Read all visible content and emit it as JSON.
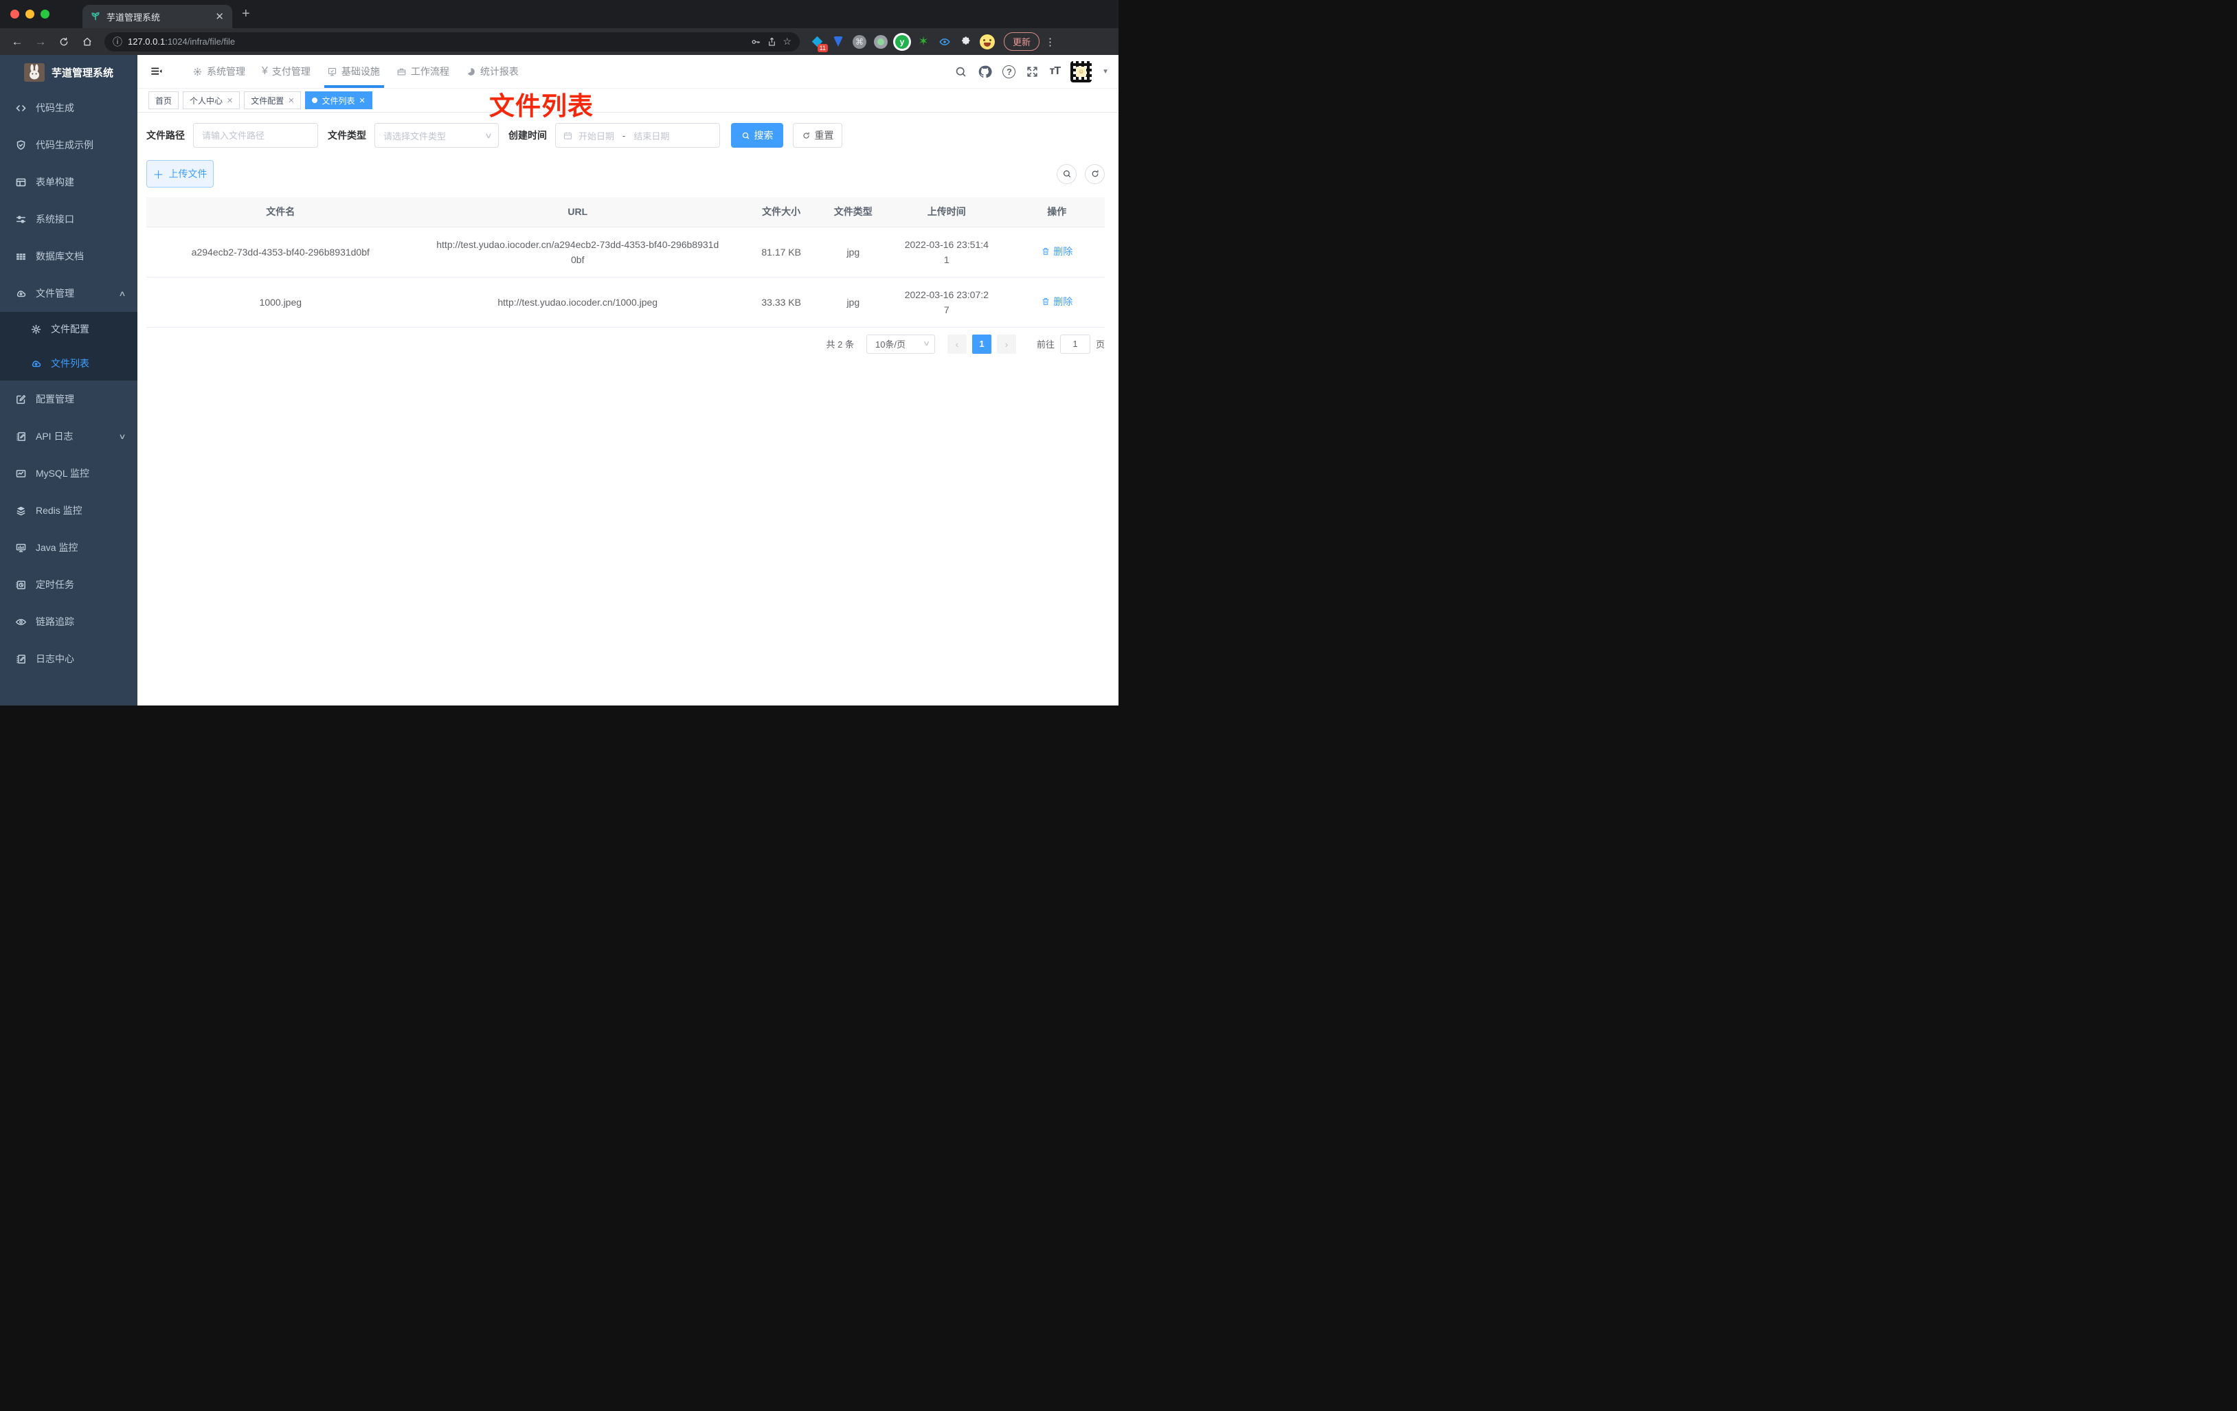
{
  "browser": {
    "tab_title": "芋道管理系统",
    "url_host": "127.0.0.1",
    "url_rest": ":1024/infra/file/file",
    "ext_badge": "11",
    "update_label": "更新"
  },
  "sidebar": {
    "title": "芋道管理系统",
    "items": [
      {
        "label": "代码生成",
        "icon": "code-icon"
      },
      {
        "label": "代码生成示例",
        "icon": "shield-check-icon"
      },
      {
        "label": "表单构建",
        "icon": "form-icon"
      },
      {
        "label": "系统接口",
        "icon": "sliders-icon"
      },
      {
        "label": "数据库文档",
        "icon": "table-icon"
      },
      {
        "label": "文件管理",
        "icon": "cloud-download-icon",
        "expanded": true
      },
      {
        "label": "文件配置",
        "icon": "gear-icon",
        "sub": true
      },
      {
        "label": "文件列表",
        "icon": "cloud-upload-icon",
        "sub": true,
        "active": true
      },
      {
        "label": "配置管理",
        "icon": "edit-icon"
      },
      {
        "label": "API 日志",
        "icon": "log-icon",
        "collapsed": true
      },
      {
        "label": "MySQL 监控",
        "icon": "chart-icon"
      },
      {
        "label": "Redis 监控",
        "icon": "layers-icon"
      },
      {
        "label": "Java 监控",
        "icon": "monitor-icon"
      },
      {
        "label": "定时任务",
        "icon": "schedule-icon"
      },
      {
        "label": "链路追踪",
        "icon": "eye-icon"
      },
      {
        "label": "日志中心",
        "icon": "log-center-icon"
      }
    ]
  },
  "topnav": {
    "items": [
      {
        "label": "系统管理",
        "icon": "gear-icon"
      },
      {
        "label": "支付管理",
        "icon": "yen-icon"
      },
      {
        "label": "基础设施",
        "icon": "infra-icon",
        "active": true
      },
      {
        "label": "工作流程",
        "icon": "briefcase-icon"
      },
      {
        "label": "统计报表",
        "icon": "pie-chart-icon"
      }
    ]
  },
  "tags": [
    {
      "label": "首页"
    },
    {
      "label": "个人中心",
      "closable": true
    },
    {
      "label": "文件配置",
      "closable": true
    },
    {
      "label": "文件列表",
      "closable": true,
      "active": true
    }
  ],
  "annotation": {
    "text": "文件列表"
  },
  "filter": {
    "path_label": "文件路径",
    "path_placeholder": "请输入文件路径",
    "type_label": "文件类型",
    "type_placeholder": "请选择文件类型",
    "date_label": "创建时间",
    "date_start": "开始日期",
    "date_separator": "-",
    "date_end": "结束日期",
    "search_label": "搜索",
    "reset_label": "重置"
  },
  "actions": {
    "upload_label": "上传文件"
  },
  "table": {
    "headers": [
      "文件名",
      "URL",
      "文件大小",
      "文件类型",
      "上传时间",
      "操作"
    ],
    "rows": [
      {
        "name": "a294ecb2-73dd-4353-bf40-296b8931d0bf",
        "url": "http://test.yudao.iocoder.cn/a294ecb2-73dd-4353-bf40-296b8931d0bf",
        "size": "81.17 KB",
        "type": "jpg",
        "time": "2022-03-16 23:51:41",
        "action": "删除"
      },
      {
        "name": "1000.jpeg",
        "url": "http://test.yudao.iocoder.cn/1000.jpeg",
        "size": "33.33 KB",
        "type": "jpg",
        "time": "2022-03-16 23:07:27",
        "action": "删除"
      }
    ]
  },
  "pagination": {
    "total": "共 2 条",
    "page_size": "10条/页",
    "current": "1",
    "goto_label": "前往",
    "goto_value": "1",
    "page_unit": "页"
  },
  "colors": {
    "primary": "#409eff",
    "annotation_red": "#f5280c",
    "sidebar_bg": "#304156",
    "sidebar_submenu_bg": "#1f2d3d"
  }
}
